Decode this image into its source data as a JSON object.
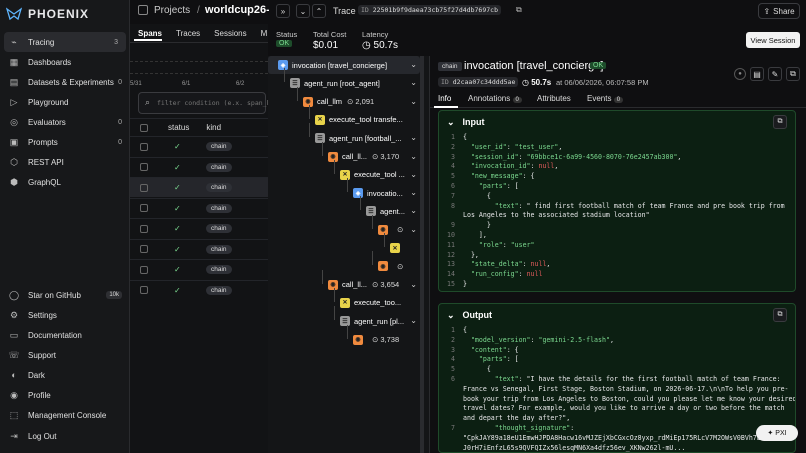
{
  "app": {
    "name": "PHOENIX"
  },
  "sidebar": {
    "items": [
      {
        "label": "Tracing",
        "count": "3"
      },
      {
        "label": "Dashboards",
        "count": ""
      },
      {
        "label": "Datasets & Experiments",
        "count": "0"
      },
      {
        "label": "Playground",
        "count": ""
      },
      {
        "label": "Evaluators",
        "count": "0"
      },
      {
        "label": "Prompts",
        "count": "0"
      },
      {
        "label": "REST API",
        "count": ""
      },
      {
        "label": "GraphQL",
        "count": ""
      }
    ],
    "bottom": [
      {
        "label": "Star on GitHub",
        "badge": "10k"
      },
      {
        "label": "Settings"
      },
      {
        "label": "Documentation"
      },
      {
        "label": "Support"
      },
      {
        "label": "Dark"
      },
      {
        "label": "Profile"
      },
      {
        "label": "Management Console"
      },
      {
        "label": "Log Out"
      }
    ]
  },
  "breadcrumb": {
    "projects": "Projects",
    "project": "worldcup26-fc"
  },
  "trace": {
    "label": "Trace",
    "id_prefix": "ID",
    "id": "22501b9f9daea73cb75f27d4db7697cb",
    "status_label": "Status",
    "status": "OK",
    "cost_label": "Total Cost",
    "cost": "$0.01",
    "latency_label": "Latency",
    "latency": "50.7s",
    "share": "Share",
    "view_session": "View Session"
  },
  "spans_tabs": [
    "Spans",
    "Traces",
    "Sessions",
    "M"
  ],
  "timeline": [
    "5/31",
    "6/1",
    "6/2"
  ],
  "filter": {
    "placeholder": "filter condition (e.x. span_k"
  },
  "table": {
    "headers": [
      "status",
      "kind"
    ],
    "rows": [
      {
        "status": "✓",
        "kind": "chain"
      },
      {
        "status": "✓",
        "kind": "chain"
      },
      {
        "status": "✓",
        "kind": "chain"
      },
      {
        "status": "✓",
        "kind": "chain"
      },
      {
        "status": "✓",
        "kind": "chain"
      },
      {
        "status": "✓",
        "kind": "chain"
      },
      {
        "status": "✓",
        "kind": "chain"
      },
      {
        "status": "✓",
        "kind": "chain"
      }
    ]
  },
  "tree": [
    {
      "label": "invocation [travel_concierge]",
      "kind": "inv",
      "tokens": ""
    },
    {
      "label": "agent_run [root_agent]",
      "kind": "agent",
      "tokens": ""
    },
    {
      "label": "call_llm",
      "kind": "llm",
      "tokens": "2,091"
    },
    {
      "label": "execute_tool transfe...",
      "kind": "tool",
      "tokens": ""
    },
    {
      "label": "agent_run [football_...",
      "kind": "agent",
      "tokens": ""
    },
    {
      "label": "call_ll...",
      "kind": "llm",
      "tokens": "3,170"
    },
    {
      "label": "execute_tool ...",
      "kind": "tool",
      "tokens": ""
    },
    {
      "label": "invocatio...",
      "kind": "inv",
      "tokens": ""
    },
    {
      "label": "agent...",
      "kind": "agent",
      "tokens": ""
    },
    {
      "label": "",
      "kind": "llm",
      "tokens": ""
    },
    {
      "label": "",
      "kind": "tool",
      "tokens": ""
    },
    {
      "label": "",
      "kind": "llm",
      "tokens": ""
    },
    {
      "label": "call_ll...",
      "kind": "llm",
      "tokens": "3,654"
    },
    {
      "label": "execute_too...",
      "kind": "tool",
      "tokens": ""
    },
    {
      "label": "agent_run [pl...",
      "kind": "agent",
      "tokens": ""
    },
    {
      "label": "",
      "kind": "llm",
      "tokens": "3,738"
    }
  ],
  "span": {
    "kind": "chain",
    "title": "invocation [travel_concierge]",
    "status": "OK",
    "id_prefix": "ID",
    "id": "d2caa07c34ddd5ae",
    "latency": "50.7s",
    "at": "at 06/06/2026, 06:07:58 PM"
  },
  "detail_tabs": [
    {
      "label": "Info",
      "count": ""
    },
    {
      "label": "Annotations",
      "count": "0"
    },
    {
      "label": "Attributes",
      "count": ""
    },
    {
      "label": "Events",
      "count": "0"
    }
  ],
  "input": {
    "title": "Input",
    "lines": [
      "{",
      "  \"user_id\": \"test_user\",",
      "  \"session_id\": \"69bbce1c-6a99-4560-8070-76e2457ab300\",",
      "  \"invocation_id\": null,",
      "  \"new_message\": {",
      "    \"parts\": [",
      "      {",
      "        \"text\": \" find first football match of team France and pre book trip from",
      "Los Angeles to the associated stadium location\"",
      "      }",
      "    ],",
      "    \"role\": \"user\"",
      "  },",
      "  \"state_delta\": null,",
      "  \"run_config\": null",
      "}"
    ]
  },
  "input_nums": [
    "1",
    "2",
    "3",
    "4",
    "5",
    "6",
    "7",
    "8",
    "",
    "9",
    "10",
    "11",
    "12",
    "13",
    "14",
    "15"
  ],
  "output": {
    "title": "Output",
    "lines": [
      "{",
      "  \"model_version\": \"gemini-2.5-flash\",",
      "  \"content\": {",
      "    \"parts\": [",
      "      {",
      "        \"text\": \"I have the details for the first football match of team France:",
      "France vs Senegal, First Stage, Boston Stadium, on 2026-06-17.\\n\\nTo help you pre-",
      "book your trip from Los Angeles to Boston, could you please let me know your desired",
      "travel dates? For example, would you like to arrive a day or two before the match",
      "and depart the day after?\",",
      "        \"thought_signature\":",
      "\"CpkJAY89a18eU1EmwHJPDA8Hacw16vMJZEjXbCGxcOz8yxp_rdMiEp175RLcV7M2OWsV0BVh7LP8xL",
      "J0rH7iEnfzL65s9QVFQIZx56lesqMN6Xa4dfz56ev_XKNw262l-mU..."
    ]
  },
  "output_nums": [
    "1",
    "2",
    "3",
    "4",
    "5",
    "6",
    "",
    "",
    "",
    "",
    "7",
    "",
    ""
  ],
  "pxi": "PXI"
}
